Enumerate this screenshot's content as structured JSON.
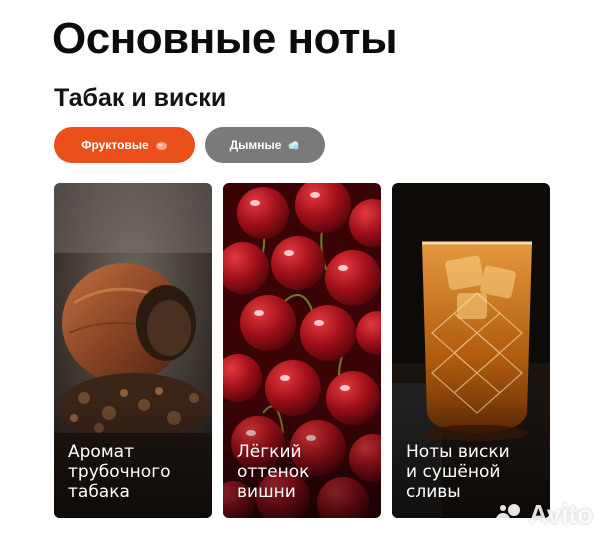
{
  "header": {
    "title": "Основные ноты",
    "subtitle": "Табак и виски"
  },
  "chips": [
    {
      "label": "Фруктовые",
      "icon": "cherry-icon",
      "color": "#ea4f1c"
    },
    {
      "label": "Дымные",
      "icon": "smoke-icon",
      "color": "#7a7a7a"
    }
  ],
  "cards": [
    {
      "label": "Аромат\nтрубочного\nтабака",
      "image": "tobacco-pipe-image"
    },
    {
      "label": "Лёгкий\nоттенок\nвишни",
      "image": "cherries-image"
    },
    {
      "label": "Ноты виски\nи сушёной\nсливы",
      "image": "whisky-glass-image"
    }
  ],
  "watermark": {
    "text": "Avito"
  }
}
